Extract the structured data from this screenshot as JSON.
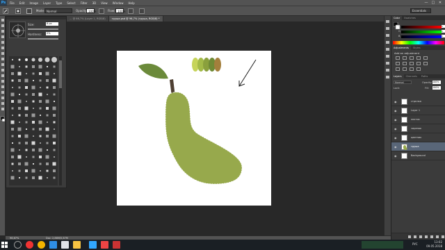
{
  "app": {
    "logo": "Ps",
    "menus": [
      "File",
      "Edit",
      "Image",
      "Layer",
      "Type",
      "Select",
      "Filter",
      "3D",
      "View",
      "Window",
      "Help"
    ],
    "window_controls": [
      "—",
      "□",
      "✕"
    ]
  },
  "options_bar": {
    "mode_label": "Mode:",
    "mode_value": "Normal",
    "opacity_label": "Opacity:",
    "opacity_value": "100%",
    "flow_label": "Flow:",
    "flow_value": "100%",
    "workspace": "Essentials"
  },
  "brush_panel": {
    "size_label": "Size:",
    "size_value": "8 px",
    "hardness_label": "Hardness:",
    "hardness_value": "0%"
  },
  "document_tabs": [
    {
      "label": "... @ 66,7% (Layer 1, RGB/8)",
      "active": false
    },
    {
      "label": "груша.psd @ 96,7% (груша, RGB/8) *",
      "active": true
    }
  ],
  "status_bar": {
    "zoom": "96,67%",
    "doc_info": "Doc: 2,86M/5,67M"
  },
  "right_panels": {
    "color_tabs": [
      "Color",
      "Swatches"
    ],
    "color_rows": [
      {
        "label": "R",
        "value": "0"
      },
      {
        "label": "G",
        "value": "0"
      },
      {
        "label": "B",
        "value": "0"
      }
    ],
    "adjustment_tabs": [
      "Adjustments",
      "Styles"
    ],
    "adjustments_title": "Add an adjustment",
    "layers_tabs": [
      "Layers",
      "Channels",
      "Paths"
    ],
    "blend_mode": "Normal",
    "layer_opacity_label": "Opacity:",
    "layer_opacity": "100%",
    "lock_label": "Lock:",
    "fill_label": "Fill:",
    "fill": "100%",
    "layers": [
      {
        "name": "стрелка",
        "active": false
      },
      {
        "name": "Layer 1",
        "active": false
      },
      {
        "name": "листок",
        "active": false
      },
      {
        "name": "черенок",
        "active": false
      },
      {
        "name": "цветник",
        "active": false
      },
      {
        "name": "груша",
        "active": true
      },
      {
        "name": "Background",
        "active": false
      }
    ]
  },
  "taskbar": {
    "time": "13:02",
    "date": "09.05.2018",
    "language": "РУС"
  },
  "colors": {
    "pear": "#97a94c",
    "leaf": "#6b8a3a",
    "stem": "#4e3f32",
    "swatches": [
      "#c6d45a",
      "#a3ba48",
      "#8aa03d",
      "#6f8a35",
      "#a37f3c"
    ]
  }
}
